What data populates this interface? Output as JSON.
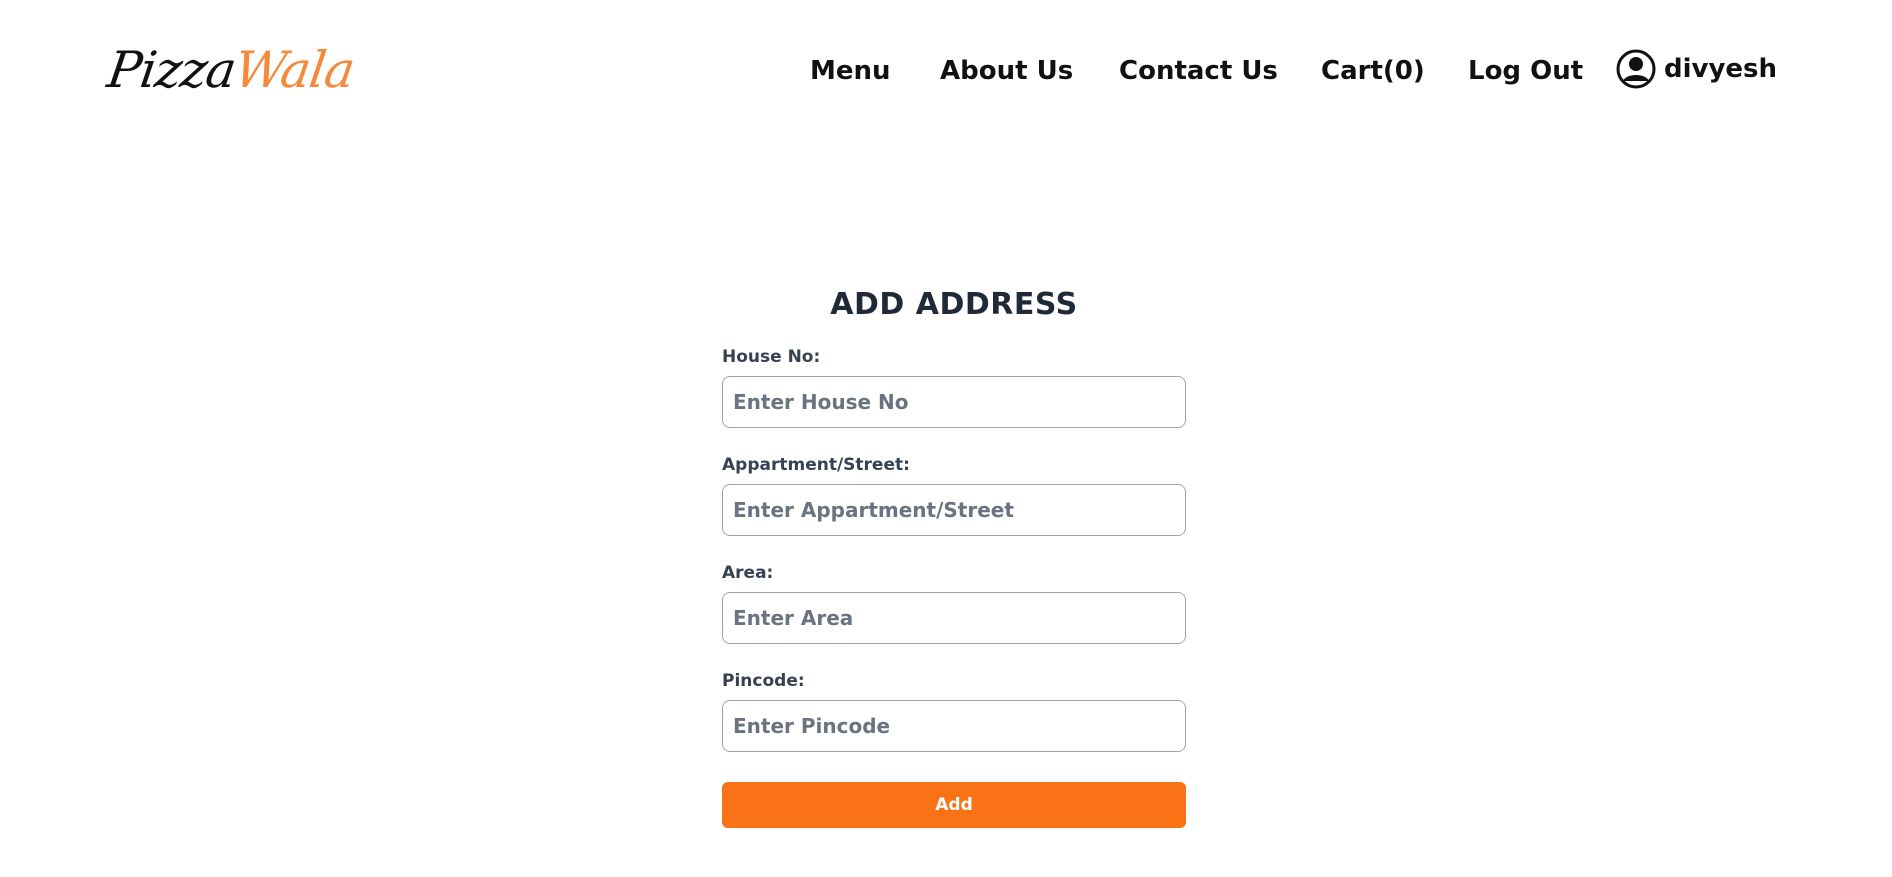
{
  "brand": {
    "name_part1": "Pizza",
    "name_part2": "Wala",
    "color_primary": "#111111",
    "color_accent": "#f58a3c"
  },
  "nav": {
    "items": [
      {
        "label": "Menu"
      },
      {
        "label": "About Us"
      },
      {
        "label": "Contact Us"
      },
      {
        "label": "Cart(0)"
      },
      {
        "label": "Log Out"
      }
    ],
    "user": {
      "name": "divyesh",
      "icon": "user-circle-icon"
    }
  },
  "form": {
    "title": "ADD ADDRESS",
    "fields": [
      {
        "label": "House No:",
        "placeholder": "Enter House No",
        "value": ""
      },
      {
        "label": "Appartment/Street:",
        "placeholder": "Enter Appartment/Street",
        "value": ""
      },
      {
        "label": "Area:",
        "placeholder": "Enter Area",
        "value": ""
      },
      {
        "label": "Pincode:",
        "placeholder": "Enter Pincode",
        "value": ""
      }
    ],
    "submit_label": "Add",
    "accent_color": "#f97316"
  }
}
